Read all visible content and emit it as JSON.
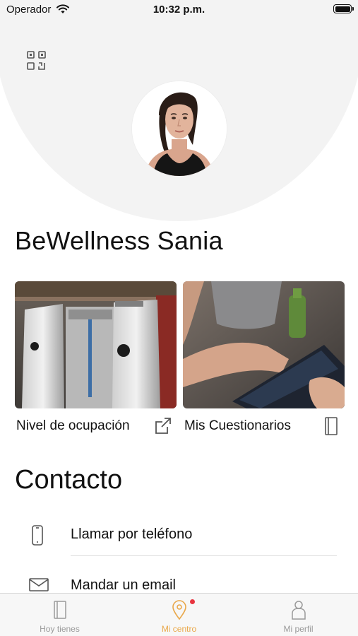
{
  "status_bar": {
    "carrier": "Operador",
    "time": "10:32 p.m."
  },
  "header": {
    "qr_icon": "qr-code-icon",
    "avatar_icon": "woman-profile-photo"
  },
  "center": {
    "name": "BeWellness Sania"
  },
  "cards": [
    {
      "label": "Nivel de ocupación",
      "icon": "external-link-icon",
      "image": "gym-turnstile-photo"
    },
    {
      "label": "Mis Cuestionarios",
      "icon": "notebook-icon",
      "image": "tablet-hands-photo"
    }
  ],
  "contact": {
    "title": "Contacto",
    "items": [
      {
        "label": "Llamar por teléfono",
        "icon": "phone-icon"
      },
      {
        "label": "Mandar un email",
        "icon": "mail-icon"
      }
    ]
  },
  "tab_bar": {
    "items": [
      {
        "label": "Hoy tienes",
        "icon": "notebook-icon",
        "active": false
      },
      {
        "label": "Mi centro",
        "icon": "location-pin-icon",
        "active": true
      },
      {
        "label": "Mi perfil",
        "icon": "person-icon",
        "active": false
      }
    ],
    "colors": {
      "active": "#e9a84a",
      "inactive": "#9a9a9a",
      "badge": "#e8343f"
    }
  }
}
